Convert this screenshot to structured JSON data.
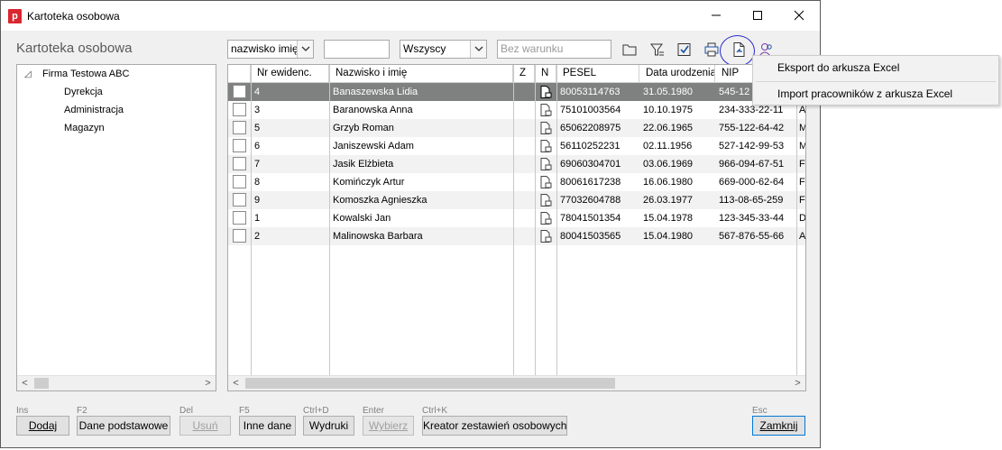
{
  "window": {
    "title": "Kartoteka osobowa",
    "app_icon_letter": "p"
  },
  "heading": "Kartoteka osobowa",
  "filters": {
    "sort_field": "nazwisko imię",
    "search_value": "",
    "status": "Wszyscy",
    "condition_placeholder": "Bez warunku"
  },
  "tree": {
    "root": "Firma Testowa ABC",
    "children": [
      "Dyrekcja",
      "Administracja",
      "Magazyn"
    ],
    "toggle_glyph": "◿"
  },
  "grid": {
    "columns": [
      "Nr ewidenc.",
      "Nazwisko i imię",
      "Z",
      "N",
      "PESEL",
      "Data urodzenia",
      "NIP"
    ],
    "rows": [
      {
        "nr": "4",
        "name": "Banaszewska Lidia",
        "pesel": "80053114763",
        "birth": "31.05.1980",
        "nip": "545-12",
        "extra": ""
      },
      {
        "nr": "3",
        "name": "Baranowska Anna",
        "pesel": "75101003564",
        "birth": "10.10.1975",
        "nip": "234-333-22-11",
        "extra": "A"
      },
      {
        "nr": "5",
        "name": "Grzyb Roman",
        "pesel": "65062208975",
        "birth": "22.06.1965",
        "nip": "755-122-64-42",
        "extra": "M"
      },
      {
        "nr": "6",
        "name": "Janiszewski Adam",
        "pesel": "56110252231",
        "birth": "02.11.1956",
        "nip": "527-142-99-53",
        "extra": "M"
      },
      {
        "nr": "7",
        "name": "Jasik Elżbieta",
        "pesel": "69060304701",
        "birth": "03.06.1969",
        "nip": "966-094-67-51",
        "extra": "F"
      },
      {
        "nr": "8",
        "name": "Komińczyk Artur",
        "pesel": "80061617238",
        "birth": "16.06.1980",
        "nip": "669-000-62-64",
        "extra": "F"
      },
      {
        "nr": "9",
        "name": "Komoszka Agnieszka",
        "pesel": "77032604788",
        "birth": "26.03.1977",
        "nip": "113-08-65-259",
        "extra": "F"
      },
      {
        "nr": "1",
        "name": "Kowalski Jan",
        "pesel": "78041501354",
        "birth": "15.04.1978",
        "nip": "123-345-33-44",
        "extra": "D"
      },
      {
        "nr": "2",
        "name": "Malinowska Barbara",
        "pesel": "80041503565",
        "birth": "15.04.1980",
        "nip": "567-876-55-66",
        "extra": "A"
      }
    ]
  },
  "menu": {
    "items": [
      "Eksport do arkusza Excel",
      "Import pracowników z arkusza Excel"
    ]
  },
  "scroll": {
    "left": "<",
    "right": ">"
  },
  "buttons": [
    {
      "shortcut": "Ins",
      "label": "Dodaj"
    },
    {
      "shortcut": "F2",
      "label": "Dane podstawowe"
    },
    {
      "shortcut": "Del",
      "label": "Usuń"
    },
    {
      "shortcut": "F5",
      "label": "Inne dane"
    },
    {
      "shortcut": "Ctrl+D",
      "label": "Wydruki"
    },
    {
      "shortcut": "Enter",
      "label": "Wybierz"
    },
    {
      "shortcut": "Ctrl+K",
      "label": "Kreator zestawień osobowych"
    },
    {
      "shortcut": "Esc",
      "label": "Zamknij"
    }
  ]
}
